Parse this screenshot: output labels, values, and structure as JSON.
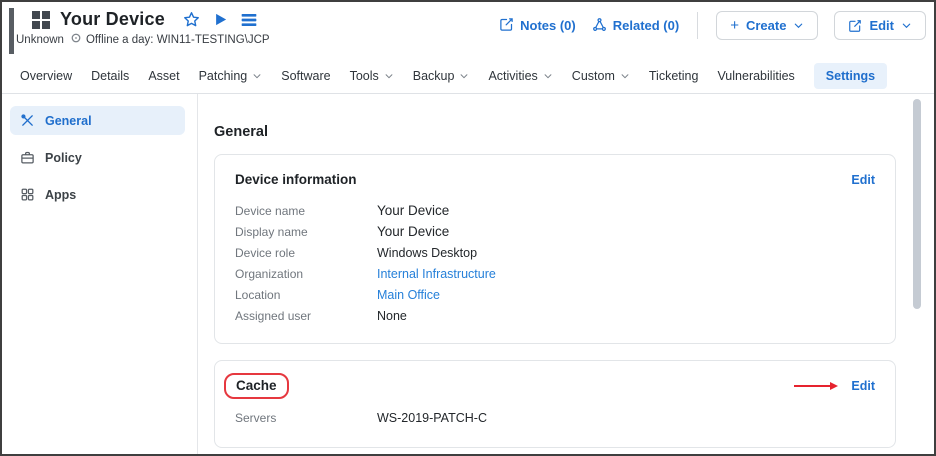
{
  "header": {
    "title": "Your Device",
    "status": {
      "state": "Unknown",
      "message": "Offline a day: WIN11-TESTING\\JCP"
    },
    "actions": {
      "notes_label": "Notes (0)",
      "related_label": "Related (0)",
      "create_label": "Create",
      "edit_label": "Edit"
    }
  },
  "tabs": {
    "items": [
      {
        "label": "Overview"
      },
      {
        "label": "Details"
      },
      {
        "label": "Asset"
      },
      {
        "label": "Patching",
        "dropdown": true
      },
      {
        "label": "Software"
      },
      {
        "label": "Tools",
        "dropdown": true
      },
      {
        "label": "Backup",
        "dropdown": true
      },
      {
        "label": "Activities",
        "dropdown": true
      },
      {
        "label": "Custom",
        "dropdown": true
      },
      {
        "label": "Ticketing"
      },
      {
        "label": "Vulnerabilities"
      },
      {
        "label": "Settings",
        "active": true
      }
    ]
  },
  "sidebar": {
    "items": [
      {
        "label": "General",
        "icon": "tools-icon",
        "active": true
      },
      {
        "label": "Policy",
        "icon": "briefcase-icon"
      },
      {
        "label": "Apps",
        "icon": "apps-grid-icon"
      }
    ]
  },
  "main": {
    "heading": "General",
    "device_info_card": {
      "title": "Device information",
      "edit_label": "Edit",
      "fields": [
        {
          "label": "Device name",
          "value": "Your Device"
        },
        {
          "label": "Display name",
          "value": "Your Device"
        },
        {
          "label": "Device role",
          "value": "Windows Desktop"
        },
        {
          "label": "Organization",
          "value": "Internal Infrastructure"
        },
        {
          "label": "Location",
          "value": "Main Office"
        },
        {
          "label": "Assigned user",
          "value": "None"
        }
      ]
    },
    "cache_card": {
      "title": "Cache",
      "edit_label": "Edit",
      "fields": [
        {
          "label": "Servers",
          "value": "WS-2019-PATCH-C"
        }
      ]
    }
  },
  "colors": {
    "accent_blue": "#2070cf",
    "active_tab_bg": "#e8f1fb",
    "annotation_red": "#e6232e",
    "frame_border": "#3f3f3f",
    "scrollbar": "#c5cbd3"
  }
}
